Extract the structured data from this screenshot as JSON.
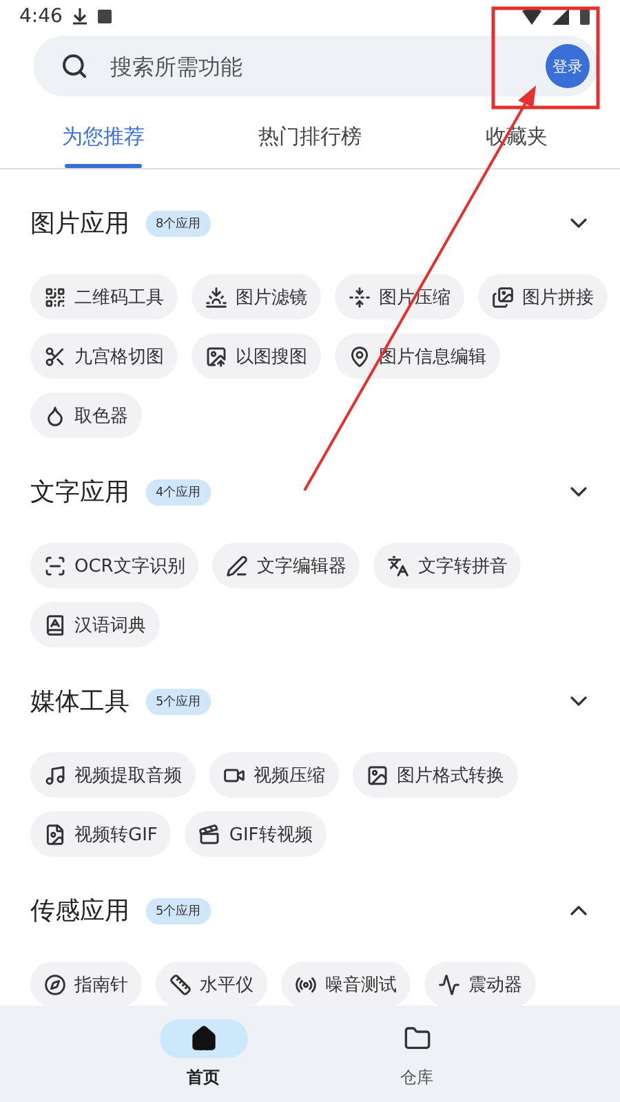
{
  "status_bar": {
    "time": "4:46"
  },
  "search": {
    "placeholder": "搜索所需功能",
    "login_button": "登录"
  },
  "tabs": [
    {
      "label": "为您推荐",
      "selected": true
    },
    {
      "label": "热门排行榜",
      "selected": false
    },
    {
      "label": "收藏夹",
      "selected": false
    }
  ],
  "sections": [
    {
      "title": "图片应用",
      "badge": "8个应用",
      "expanded": false,
      "items": [
        "二维码工具",
        "图片滤镜",
        "图片压缩",
        "图片拼接",
        "九宫格切图",
        "以图搜图",
        "图片信息编辑",
        "取色器"
      ]
    },
    {
      "title": "文字应用",
      "badge": "4个应用",
      "expanded": false,
      "items": [
        "OCR文字识别",
        "文字编辑器",
        "文字转拼音",
        "汉语词典"
      ]
    },
    {
      "title": "媒体工具",
      "badge": "5个应用",
      "expanded": false,
      "items": [
        "视频提取音频",
        "视频压缩",
        "图片格式转换",
        "视频转GIF",
        "GIF转视频"
      ]
    },
    {
      "title": "传感应用",
      "badge": "5个应用",
      "expanded": true,
      "items": [
        "指南针",
        "水平仪",
        "噪音测试",
        "震动器"
      ]
    }
  ],
  "bottom_nav": [
    {
      "label": "首页",
      "selected": true
    },
    {
      "label": "仓库",
      "selected": false
    }
  ]
}
